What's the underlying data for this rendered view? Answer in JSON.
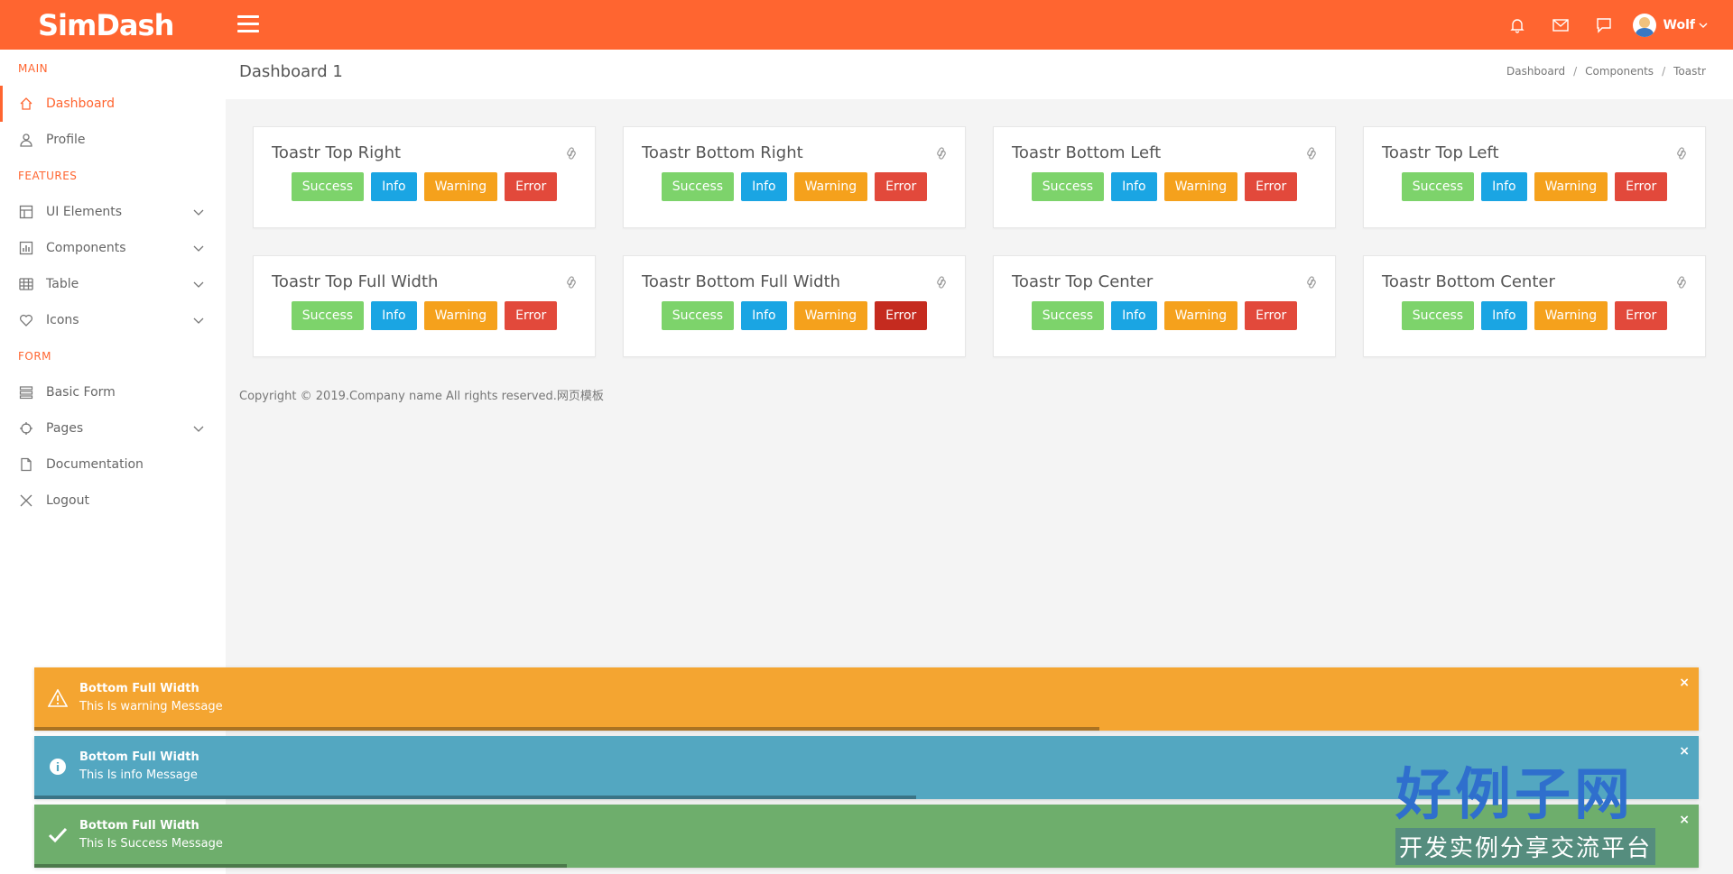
{
  "app": {
    "logo": "SimDash",
    "user_name": "Wolf"
  },
  "topbar": {
    "icons": [
      "bell-icon",
      "mail-icon",
      "chat-icon"
    ]
  },
  "sidebar": {
    "sections": {
      "main": "MAIN",
      "features": "FEATURES",
      "form": "FORM"
    },
    "items": [
      {
        "label": "Dashboard",
        "icon": "home-icon",
        "active": true
      },
      {
        "label": "Profile",
        "icon": "user-icon"
      },
      {
        "label": "UI Elements",
        "icon": "layout-icon",
        "has_sub": true
      },
      {
        "label": "Components",
        "icon": "chart-icon",
        "has_sub": true
      },
      {
        "label": "Table",
        "icon": "grid-icon",
        "has_sub": true
      },
      {
        "label": "Icons",
        "icon": "heart-icon",
        "has_sub": true
      },
      {
        "label": "Basic Form",
        "icon": "list-icon"
      },
      {
        "label": "Pages",
        "icon": "target-icon",
        "has_sub": true
      },
      {
        "label": "Documentation",
        "icon": "file-icon"
      },
      {
        "label": "Logout",
        "icon": "close-icon"
      }
    ]
  },
  "header": {
    "title": "Dashboard 1",
    "breadcrumb": [
      "Dashboard",
      "Components",
      "Toastr"
    ]
  },
  "buttons": {
    "success": "Success",
    "info": "Info",
    "warning": "Warning",
    "error": "Error"
  },
  "cards": [
    {
      "title": "Toastr Top Right"
    },
    {
      "title": "Toastr Bottom Right"
    },
    {
      "title": "Toastr Bottom Left"
    },
    {
      "title": "Toastr Top Left"
    },
    {
      "title": "Toastr Top Full Width"
    },
    {
      "title": "Toastr Bottom Full Width"
    },
    {
      "title": "Toastr Top Center"
    },
    {
      "title": "Toastr Bottom Center"
    }
  ],
  "footer": {
    "text": "Copyright © 2019.Company name All rights reserved.网页模板"
  },
  "toasts": [
    {
      "type": "warning",
      "title": "Bottom Full Width",
      "message": "This Is warning Message",
      "progress": 0.64
    },
    {
      "type": "info",
      "title": "Bottom Full Width",
      "message": "This Is info Message",
      "progress": 0.53
    },
    {
      "type": "success",
      "title": "Bottom Full Width",
      "message": "This Is Success Message",
      "progress": 0.32
    }
  ],
  "watermark": {
    "big": "好例子网",
    "small": "开发实例分享交流平台"
  },
  "colors": {
    "brand": "#ff6530",
    "success": "#7dd36b",
    "info": "#1aa5e3",
    "warning": "#f5a11c",
    "error": "#e2493b"
  }
}
